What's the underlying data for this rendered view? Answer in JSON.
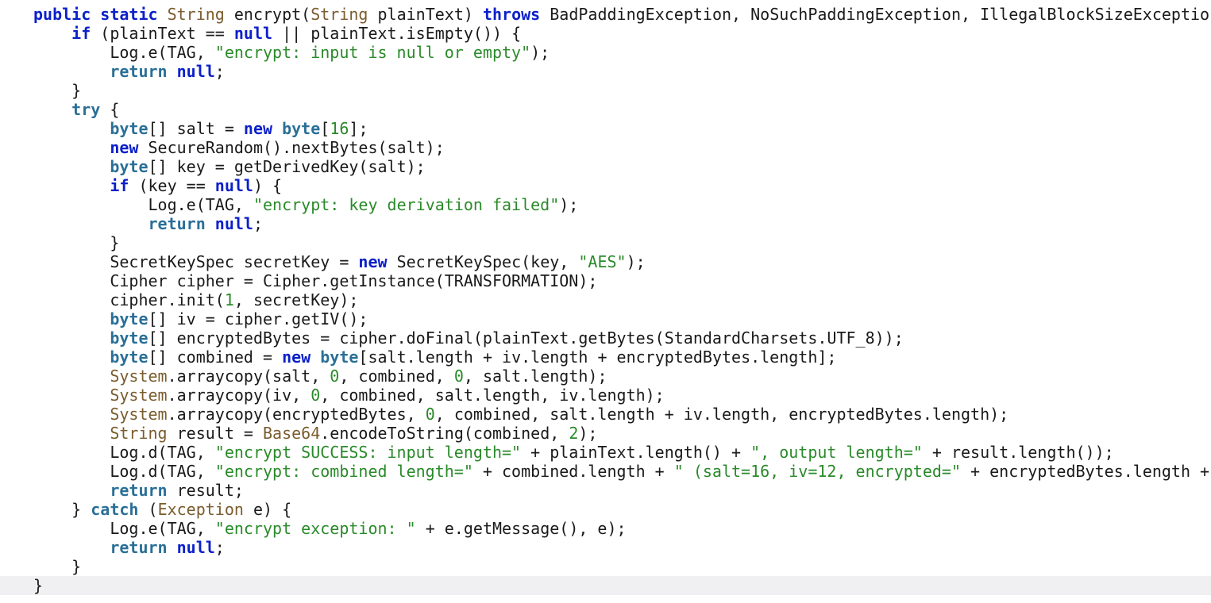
{
  "editor": {
    "language": "java",
    "current_line_index": 30,
    "colors": {
      "background": "#ffffff",
      "current_line": "#f0f0f2",
      "keyword": "#0b20c9",
      "keyword_secondary": "#2a6f97",
      "type": "#7a5c2e",
      "string": "#2a8a2a",
      "number": "#2a8a2a",
      "plain": "#1a1a1a"
    },
    "lines": [
      [
        [
          "kw",
          "public static "
        ],
        [
          "type",
          "String"
        ],
        [
          "plain",
          " encrypt("
        ],
        [
          "type",
          "String"
        ],
        [
          "plain",
          " plainText) "
        ],
        [
          "kw",
          "throws"
        ],
        [
          "plain",
          " BadPaddingException, NoSuchPaddingException, IllegalBlockSizeExceptio"
        ]
      ],
      [
        [
          "plain",
          "    "
        ],
        [
          "kw",
          "if"
        ],
        [
          "plain",
          " (plainText == "
        ],
        [
          "kw",
          "null"
        ],
        [
          "plain",
          " || plainText.isEmpty()) {"
        ]
      ],
      [
        [
          "plain",
          "        Log.e(TAG, "
        ],
        [
          "str",
          "\"encrypt: input is null or empty\""
        ],
        [
          "plain",
          ");"
        ]
      ],
      [
        [
          "plain",
          "        "
        ],
        [
          "kw2",
          "return"
        ],
        [
          "plain",
          " "
        ],
        [
          "kw",
          "null"
        ],
        [
          "plain",
          ";"
        ]
      ],
      [
        [
          "plain",
          "    }"
        ]
      ],
      [
        [
          "plain",
          "    "
        ],
        [
          "kw2",
          "try"
        ],
        [
          "plain",
          " {"
        ]
      ],
      [
        [
          "plain",
          "        "
        ],
        [
          "kw2",
          "byte"
        ],
        [
          "plain",
          "[] salt = "
        ],
        [
          "kw",
          "new"
        ],
        [
          "plain",
          " "
        ],
        [
          "kw2",
          "byte"
        ],
        [
          "plain",
          "["
        ],
        [
          "num",
          "16"
        ],
        [
          "plain",
          "];"
        ]
      ],
      [
        [
          "plain",
          "        "
        ],
        [
          "kw",
          "new"
        ],
        [
          "plain",
          " SecureRandom().nextBytes(salt);"
        ]
      ],
      [
        [
          "plain",
          "        "
        ],
        [
          "kw2",
          "byte"
        ],
        [
          "plain",
          "[] key = getDerivedKey(salt);"
        ]
      ],
      [
        [
          "plain",
          "        "
        ],
        [
          "kw",
          "if"
        ],
        [
          "plain",
          " (key == "
        ],
        [
          "kw",
          "null"
        ],
        [
          "plain",
          ") {"
        ]
      ],
      [
        [
          "plain",
          "            Log.e(TAG, "
        ],
        [
          "str",
          "\"encrypt: key derivation failed\""
        ],
        [
          "plain",
          ");"
        ]
      ],
      [
        [
          "plain",
          "            "
        ],
        [
          "kw2",
          "return"
        ],
        [
          "plain",
          " "
        ],
        [
          "kw",
          "null"
        ],
        [
          "plain",
          ";"
        ]
      ],
      [
        [
          "plain",
          "        }"
        ]
      ],
      [
        [
          "plain",
          "        SecretKeySpec secretKey = "
        ],
        [
          "kw",
          "new"
        ],
        [
          "plain",
          " SecretKeySpec(key, "
        ],
        [
          "str",
          "\"AES\""
        ],
        [
          "plain",
          ");"
        ]
      ],
      [
        [
          "plain",
          "        Cipher cipher = Cipher.getInstance(TRANSFORMATION);"
        ]
      ],
      [
        [
          "plain",
          "        cipher.init("
        ],
        [
          "num",
          "1"
        ],
        [
          "plain",
          ", secretKey);"
        ]
      ],
      [
        [
          "plain",
          "        "
        ],
        [
          "kw2",
          "byte"
        ],
        [
          "plain",
          "[] iv = cipher.getIV();"
        ]
      ],
      [
        [
          "plain",
          "        "
        ],
        [
          "kw2",
          "byte"
        ],
        [
          "plain",
          "[] encryptedBytes = cipher.doFinal(plainText.getBytes(StandardCharsets.UTF_8));"
        ]
      ],
      [
        [
          "plain",
          "        "
        ],
        [
          "kw2",
          "byte"
        ],
        [
          "plain",
          "[] combined = "
        ],
        [
          "kw",
          "new"
        ],
        [
          "plain",
          " "
        ],
        [
          "kw2",
          "byte"
        ],
        [
          "plain",
          "[salt.length + iv.length + encryptedBytes.length];"
        ]
      ],
      [
        [
          "plain",
          "        "
        ],
        [
          "type",
          "System"
        ],
        [
          "plain",
          ".arraycopy(salt, "
        ],
        [
          "num",
          "0"
        ],
        [
          "plain",
          ", combined, "
        ],
        [
          "num",
          "0"
        ],
        [
          "plain",
          ", salt.length);"
        ]
      ],
      [
        [
          "plain",
          "        "
        ],
        [
          "type",
          "System"
        ],
        [
          "plain",
          ".arraycopy(iv, "
        ],
        [
          "num",
          "0"
        ],
        [
          "plain",
          ", combined, salt.length, iv.length);"
        ]
      ],
      [
        [
          "plain",
          "        "
        ],
        [
          "type",
          "System"
        ],
        [
          "plain",
          ".arraycopy(encryptedBytes, "
        ],
        [
          "num",
          "0"
        ],
        [
          "plain",
          ", combined, salt.length + iv.length, encryptedBytes.length);"
        ]
      ],
      [
        [
          "plain",
          "        "
        ],
        [
          "type",
          "String"
        ],
        [
          "plain",
          " result = "
        ],
        [
          "type",
          "Base64"
        ],
        [
          "plain",
          ".encodeToString(combined, "
        ],
        [
          "num",
          "2"
        ],
        [
          "plain",
          ");"
        ]
      ],
      [
        [
          "plain",
          "        Log.d(TAG, "
        ],
        [
          "str",
          "\"encrypt SUCCESS: input length=\""
        ],
        [
          "plain",
          " + plainText.length() + "
        ],
        [
          "str",
          "\", output length=\""
        ],
        [
          "plain",
          " + result.length());"
        ]
      ],
      [
        [
          "plain",
          "        Log.d(TAG, "
        ],
        [
          "str",
          "\"encrypt: combined length=\""
        ],
        [
          "plain",
          " + combined.length + "
        ],
        [
          "str",
          "\" (salt=16, iv=12, encrypted=\""
        ],
        [
          "plain",
          " + encryptedBytes.length +"
        ]
      ],
      [
        [
          "plain",
          "        "
        ],
        [
          "kw2",
          "return"
        ],
        [
          "plain",
          " result;"
        ]
      ],
      [
        [
          "plain",
          "    } "
        ],
        [
          "kw2",
          "catch"
        ],
        [
          "plain",
          " ("
        ],
        [
          "type",
          "Exception"
        ],
        [
          "plain",
          " e) {"
        ]
      ],
      [
        [
          "plain",
          "        Log.e(TAG, "
        ],
        [
          "str",
          "\"encrypt exception: \""
        ],
        [
          "plain",
          " + e.getMessage(), e);"
        ]
      ],
      [
        [
          "plain",
          "        "
        ],
        [
          "kw2",
          "return"
        ],
        [
          "plain",
          " "
        ],
        [
          "kw",
          "null"
        ],
        [
          "plain",
          ";"
        ]
      ],
      [
        [
          "plain",
          "    }"
        ]
      ],
      [
        [
          "plain",
          "}"
        ]
      ]
    ]
  }
}
